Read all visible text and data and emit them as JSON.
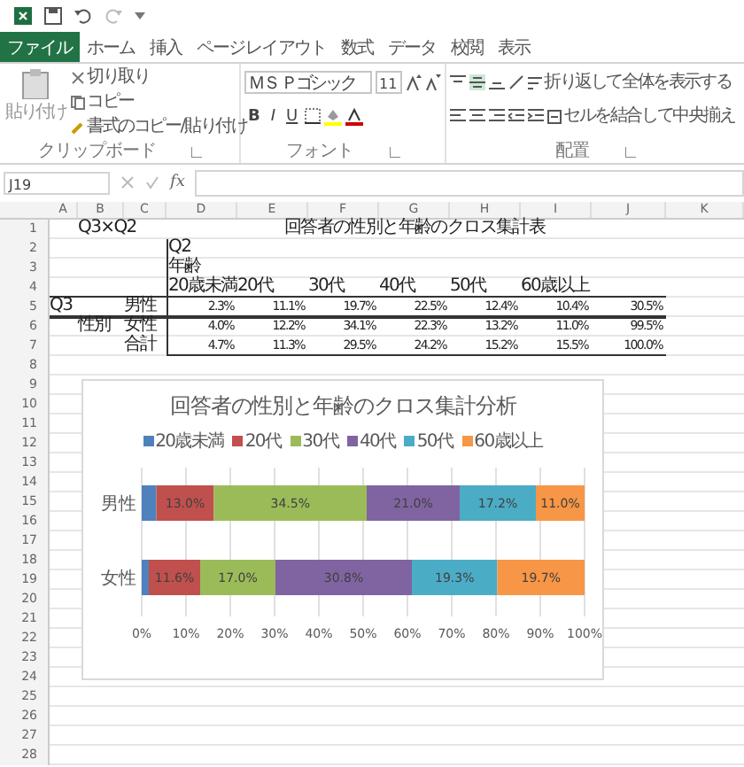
{
  "ribbon": {
    "tabs": [
      {
        "label": "ファイル",
        "selected": true
      },
      {
        "label": "ホーム",
        "selected": false
      },
      {
        "label": "挿入",
        "selected": false
      },
      {
        "label": "ページレイアウト",
        "selected": false
      },
      {
        "label": "数式",
        "selected": false
      },
      {
        "label": "データ",
        "selected": false
      },
      {
        "label": "校閲",
        "selected": false
      },
      {
        "label": "表示",
        "selected": false
      }
    ],
    "clipboard": {
      "paste": "貼り付け",
      "items": [
        "切り取り",
        "コピー",
        "書式のコピー/貼り付け"
      ],
      "label": "クリップボード"
    },
    "font": {
      "name": "ＭＳ Ｐゴシック",
      "size": "11",
      "styles": [
        "B",
        "I",
        "U"
      ],
      "label": "フォント"
    },
    "alignment": {
      "wrap": "折り返して全体を表示する",
      "merge": "セルを結合して中央揃え",
      "label": "配置"
    }
  },
  "formula_bar": {
    "name_box": "J19",
    "fx": "fx"
  },
  "sheet": {
    "columns": [
      "A",
      "B",
      "C",
      "D",
      "E",
      "F",
      "G",
      "H",
      "I",
      "J",
      "K"
    ],
    "row_numbers": [
      "1",
      "2",
      "3",
      "4",
      "5",
      "6",
      "7",
      "8",
      "9",
      "10",
      "11",
      "12",
      "13",
      "14",
      "15",
      "16",
      "17",
      "18",
      "19",
      "20",
      "21",
      "22",
      "23",
      "24",
      "25",
      "26",
      "27",
      "28"
    ],
    "corner_label": "Q3×Q2",
    "title": "回答者の性別と年齢のクロス集計表",
    "header_group": [
      "Q2",
      "年齢"
    ],
    "headers": [
      "20歳未満",
      "20代",
      "30代",
      "40代",
      "50代",
      "60歳以上"
    ],
    "row_group": [
      "Q3",
      "性別"
    ],
    "rows": [
      {
        "label": "男性",
        "values": [
          "2.3%",
          "11.1%",
          "19.7%",
          "22.5%",
          "12.4%",
          "10.4%",
          "30.5%"
        ]
      },
      {
        "label": "女性",
        "values": [
          "4.0%",
          "12.2%",
          "34.1%",
          "22.3%",
          "13.2%",
          "11.0%",
          "99.5%"
        ]
      },
      {
        "label": "合計",
        "values": [
          "4.7%",
          "11.3%",
          "29.5%",
          "24.2%",
          "15.2%",
          "15.5%",
          "100.0%"
        ]
      }
    ]
  },
  "chart": {
    "chart_data": {
      "type": "bar",
      "orientation": "horizontal",
      "stacked": true,
      "title": "回答者の性別と年齢のクロス集計分析",
      "categories": [
        "男性",
        "女性"
      ],
      "xlim": [
        0,
        100
      ],
      "xticks": [
        {
          "value": 0,
          "label": "0%"
        },
        {
          "value": 10,
          "label": "10%"
        },
        {
          "value": 20,
          "label": "20%"
        },
        {
          "value": 30,
          "label": "30%"
        },
        {
          "value": 40,
          "label": "40%"
        },
        {
          "value": 50,
          "label": "50%"
        },
        {
          "value": 60,
          "label": "60%"
        },
        {
          "value": 70,
          "label": "70%"
        },
        {
          "value": 80,
          "label": "80%"
        },
        {
          "value": 90,
          "label": "90%"
        },
        {
          "value": 100,
          "label": "100%"
        }
      ],
      "grid": true,
      "legend": "top",
      "series": [
        {
          "name": "20歳未満",
          "color": "#4f81bd",
          "values": [
            3.3,
            1.6
          ],
          "value_labels": [
            null,
            null
          ]
        },
        {
          "name": "20代",
          "color": "#c0504d",
          "values": [
            13.0,
            11.6
          ],
          "value_labels": [
            "13.0%",
            "11.6%"
          ]
        },
        {
          "name": "30代",
          "color": "#9bbb59",
          "values": [
            34.5,
            17.0
          ],
          "value_labels": [
            "34.5%",
            "17.0%"
          ]
        },
        {
          "name": "40代",
          "color": "#8064a2",
          "values": [
            21.0,
            30.8
          ],
          "value_labels": [
            "21.0%",
            "30.8%"
          ]
        },
        {
          "name": "50代",
          "color": "#4bacc6",
          "values": [
            17.2,
            19.3
          ],
          "value_labels": [
            "17.2%",
            "19.3%"
          ]
        },
        {
          "name": "60歳以上",
          "color": "#f79646",
          "values": [
            11.0,
            19.7
          ],
          "value_labels": [
            "11.0%",
            "19.7%"
          ]
        }
      ]
    }
  }
}
